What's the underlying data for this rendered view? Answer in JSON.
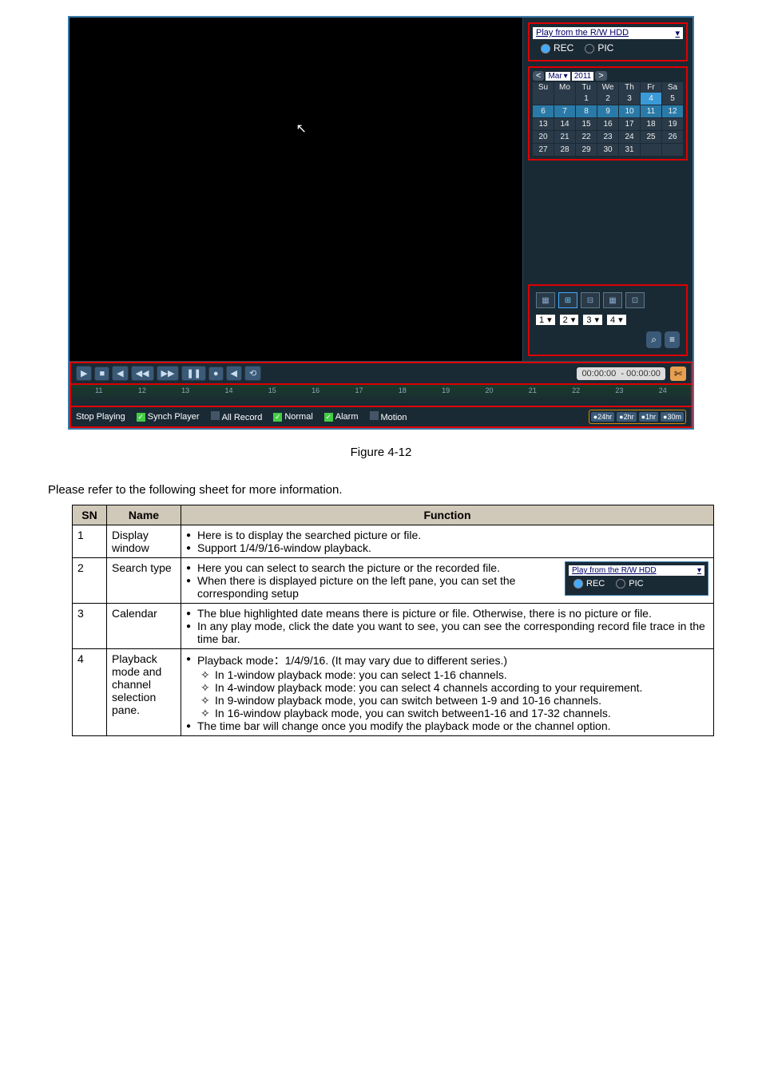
{
  "player": {
    "source_label": "Play from the R/W HDD",
    "dropdown_glyph": "▾",
    "rec_label": "REC",
    "pic_label": "PIC",
    "cursor_glyph": "↖",
    "calendar": {
      "prev": "<",
      "next": ">",
      "month": "Mar",
      "year": "2011",
      "days": [
        "Su",
        "Mo",
        "Tu",
        "We",
        "Th",
        "Fr",
        "Sa"
      ],
      "grid": [
        [
          "",
          "",
          "1",
          "2",
          "3",
          "4",
          "5"
        ],
        [
          "6",
          "7",
          "8",
          "9",
          "10",
          "11",
          "12"
        ],
        [
          "13",
          "14",
          "15",
          "16",
          "17",
          "18",
          "19"
        ],
        [
          "20",
          "21",
          "22",
          "23",
          "24",
          "25",
          "26"
        ],
        [
          "27",
          "28",
          "29",
          "30",
          "31",
          "",
          ""
        ]
      ],
      "highlight_row": [
        1
      ],
      "selected": "4"
    },
    "layouts": [
      "▦",
      "⊞",
      "⊟",
      "▦",
      "⊡"
    ],
    "chan_selects": [
      "1",
      "2",
      "3",
      "4"
    ],
    "search_label": "⌕",
    "list_label": "≡",
    "transport": {
      "buttons": [
        "▶",
        "■",
        "◀",
        "◀◀",
        "▶▶",
        "❚❚",
        "●",
        "◀",
        "⟲"
      ],
      "time_label_left": "00:00:00",
      "time_label_right": "00:00:00",
      "scissors": "✄"
    },
    "timeline_hours": [
      "11",
      "12",
      "13",
      "14",
      "15",
      "16",
      "17",
      "18",
      "19",
      "20",
      "21",
      "22",
      "23",
      "24"
    ],
    "status": {
      "stop": "Stop Playing",
      "synch": "Synch Player",
      "all_record": "All Record",
      "normal": "Normal",
      "alarm": "Alarm",
      "motion": "Motion",
      "zoom": [
        "24hr",
        "2hr",
        "1hr",
        "30m"
      ]
    }
  },
  "figure_caption": "Figure 4-12",
  "intro": "Please refer to the following sheet for more information.",
  "table": {
    "headers": [
      "SN",
      "Name",
      "Function"
    ],
    "rows": [
      {
        "sn": "1",
        "name": "Display window",
        "bullets": [
          "Here is to display the searched picture or file.",
          "Support 1/4/9/16-window playback."
        ]
      },
      {
        "sn": "2",
        "name": "Search type",
        "widget": true,
        "bullets": [
          "Here you can select to search the picture or the recorded file.",
          "When there is displayed picture on the left pane, you can set the corresponding setup"
        ]
      },
      {
        "sn": "3",
        "name": "Calendar",
        "bullets": [
          "The blue highlighted date means there is picture or file. Otherwise, there is no picture or file.",
          "In any play mode, click the date you want to see, you can see the corresponding record file trace in the time bar."
        ]
      },
      {
        "sn": "4",
        "name": "Playback mode and channel selection pane.",
        "bullets_mixed": [
          {
            "t": "b",
            "text": "Playback mode：1/4/9/16. (It may vary due to different series.)"
          },
          {
            "t": "d",
            "text": "In 1-window playback mode: you can select 1-16 channels."
          },
          {
            "t": "d",
            "text": "In 4-window playback mode: you can select 4 channels according to your requirement."
          },
          {
            "t": "d",
            "text": "In 9-window playback mode, you can switch between 1-9 and 10-16 channels."
          },
          {
            "t": "d",
            "text": "In 16-window playback mode, you can switch between1-16 and 17-32 channels."
          },
          {
            "t": "b",
            "text": "The time bar will change once you modify the playback mode or the channel option."
          }
        ]
      }
    ]
  }
}
